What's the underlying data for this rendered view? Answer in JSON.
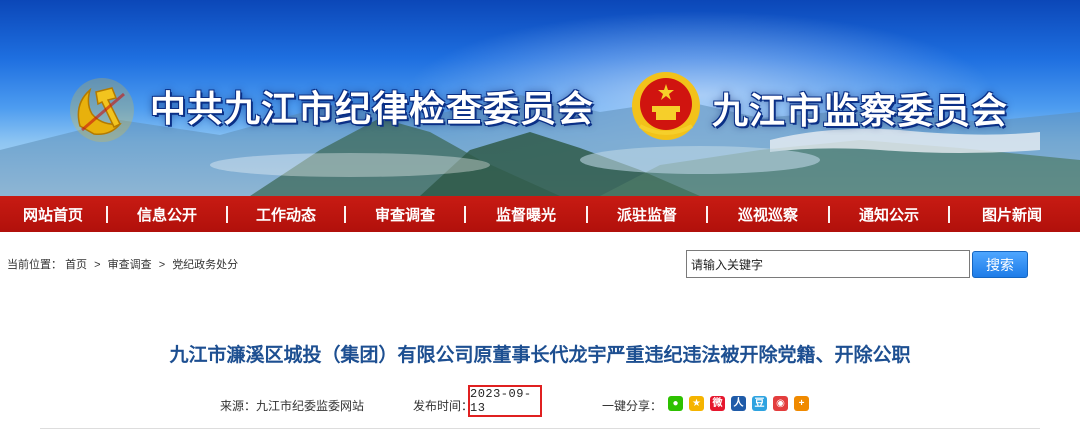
{
  "banner": {
    "title_left": "中共九江市纪律检查委员会",
    "title_right": "九江市监察委员会"
  },
  "nav": {
    "items": [
      {
        "label": "网站首页",
        "name": "nav-home"
      },
      {
        "label": "信息公开",
        "name": "nav-info-disclosure"
      },
      {
        "label": "工作动态",
        "name": "nav-work-news"
      },
      {
        "label": "审查调查",
        "name": "nav-review-investigation"
      },
      {
        "label": "监督曝光",
        "name": "nav-supervision-exposure"
      },
      {
        "label": "派驻监督",
        "name": "nav-stationed-supervision"
      },
      {
        "label": "巡视巡察",
        "name": "nav-inspection-tour"
      },
      {
        "label": "通知公示",
        "name": "nav-notices"
      },
      {
        "label": "图片新闻",
        "name": "nav-photo-news"
      }
    ]
  },
  "breadcrumb": {
    "prefix": "当前位置：",
    "items": [
      "首页",
      "审查调查",
      "党纪政务处分"
    ],
    "separator": ">"
  },
  "search": {
    "placeholder": "请输入关键字",
    "button_label": "搜索"
  },
  "article": {
    "title": "九江市濂溪区城投（集团）有限公司原董事长代龙宇严重违纪违法被开除党籍、开除公职",
    "source": "来源：九江市纪委监委网站",
    "date_label": "发布时间：",
    "date": "2023-09-13",
    "share_label": "一键分享：",
    "share_icons": [
      {
        "name": "wechat-icon",
        "glyph": "●",
        "color": "#2dc100"
      },
      {
        "name": "qzone-icon",
        "glyph": "★",
        "color": "#f5b400"
      },
      {
        "name": "weibo-icon",
        "glyph": "微",
        "color": "#e6162d"
      },
      {
        "name": "renren-icon",
        "glyph": "人",
        "color": "#1f5ba8"
      },
      {
        "name": "douban-icon",
        "glyph": "豆",
        "color": "#2ea3e0"
      },
      {
        "name": "share-circle-icon",
        "glyph": "◉",
        "color": "#e33d3d"
      },
      {
        "name": "more-share-icon",
        "glyph": "+",
        "color": "#f08a00"
      }
    ]
  },
  "colors": {
    "nav_red": "#b8120c",
    "title_blue": "#1d4f91",
    "highlight_red": "#e02020",
    "search_blue": "#1e7ce8"
  }
}
